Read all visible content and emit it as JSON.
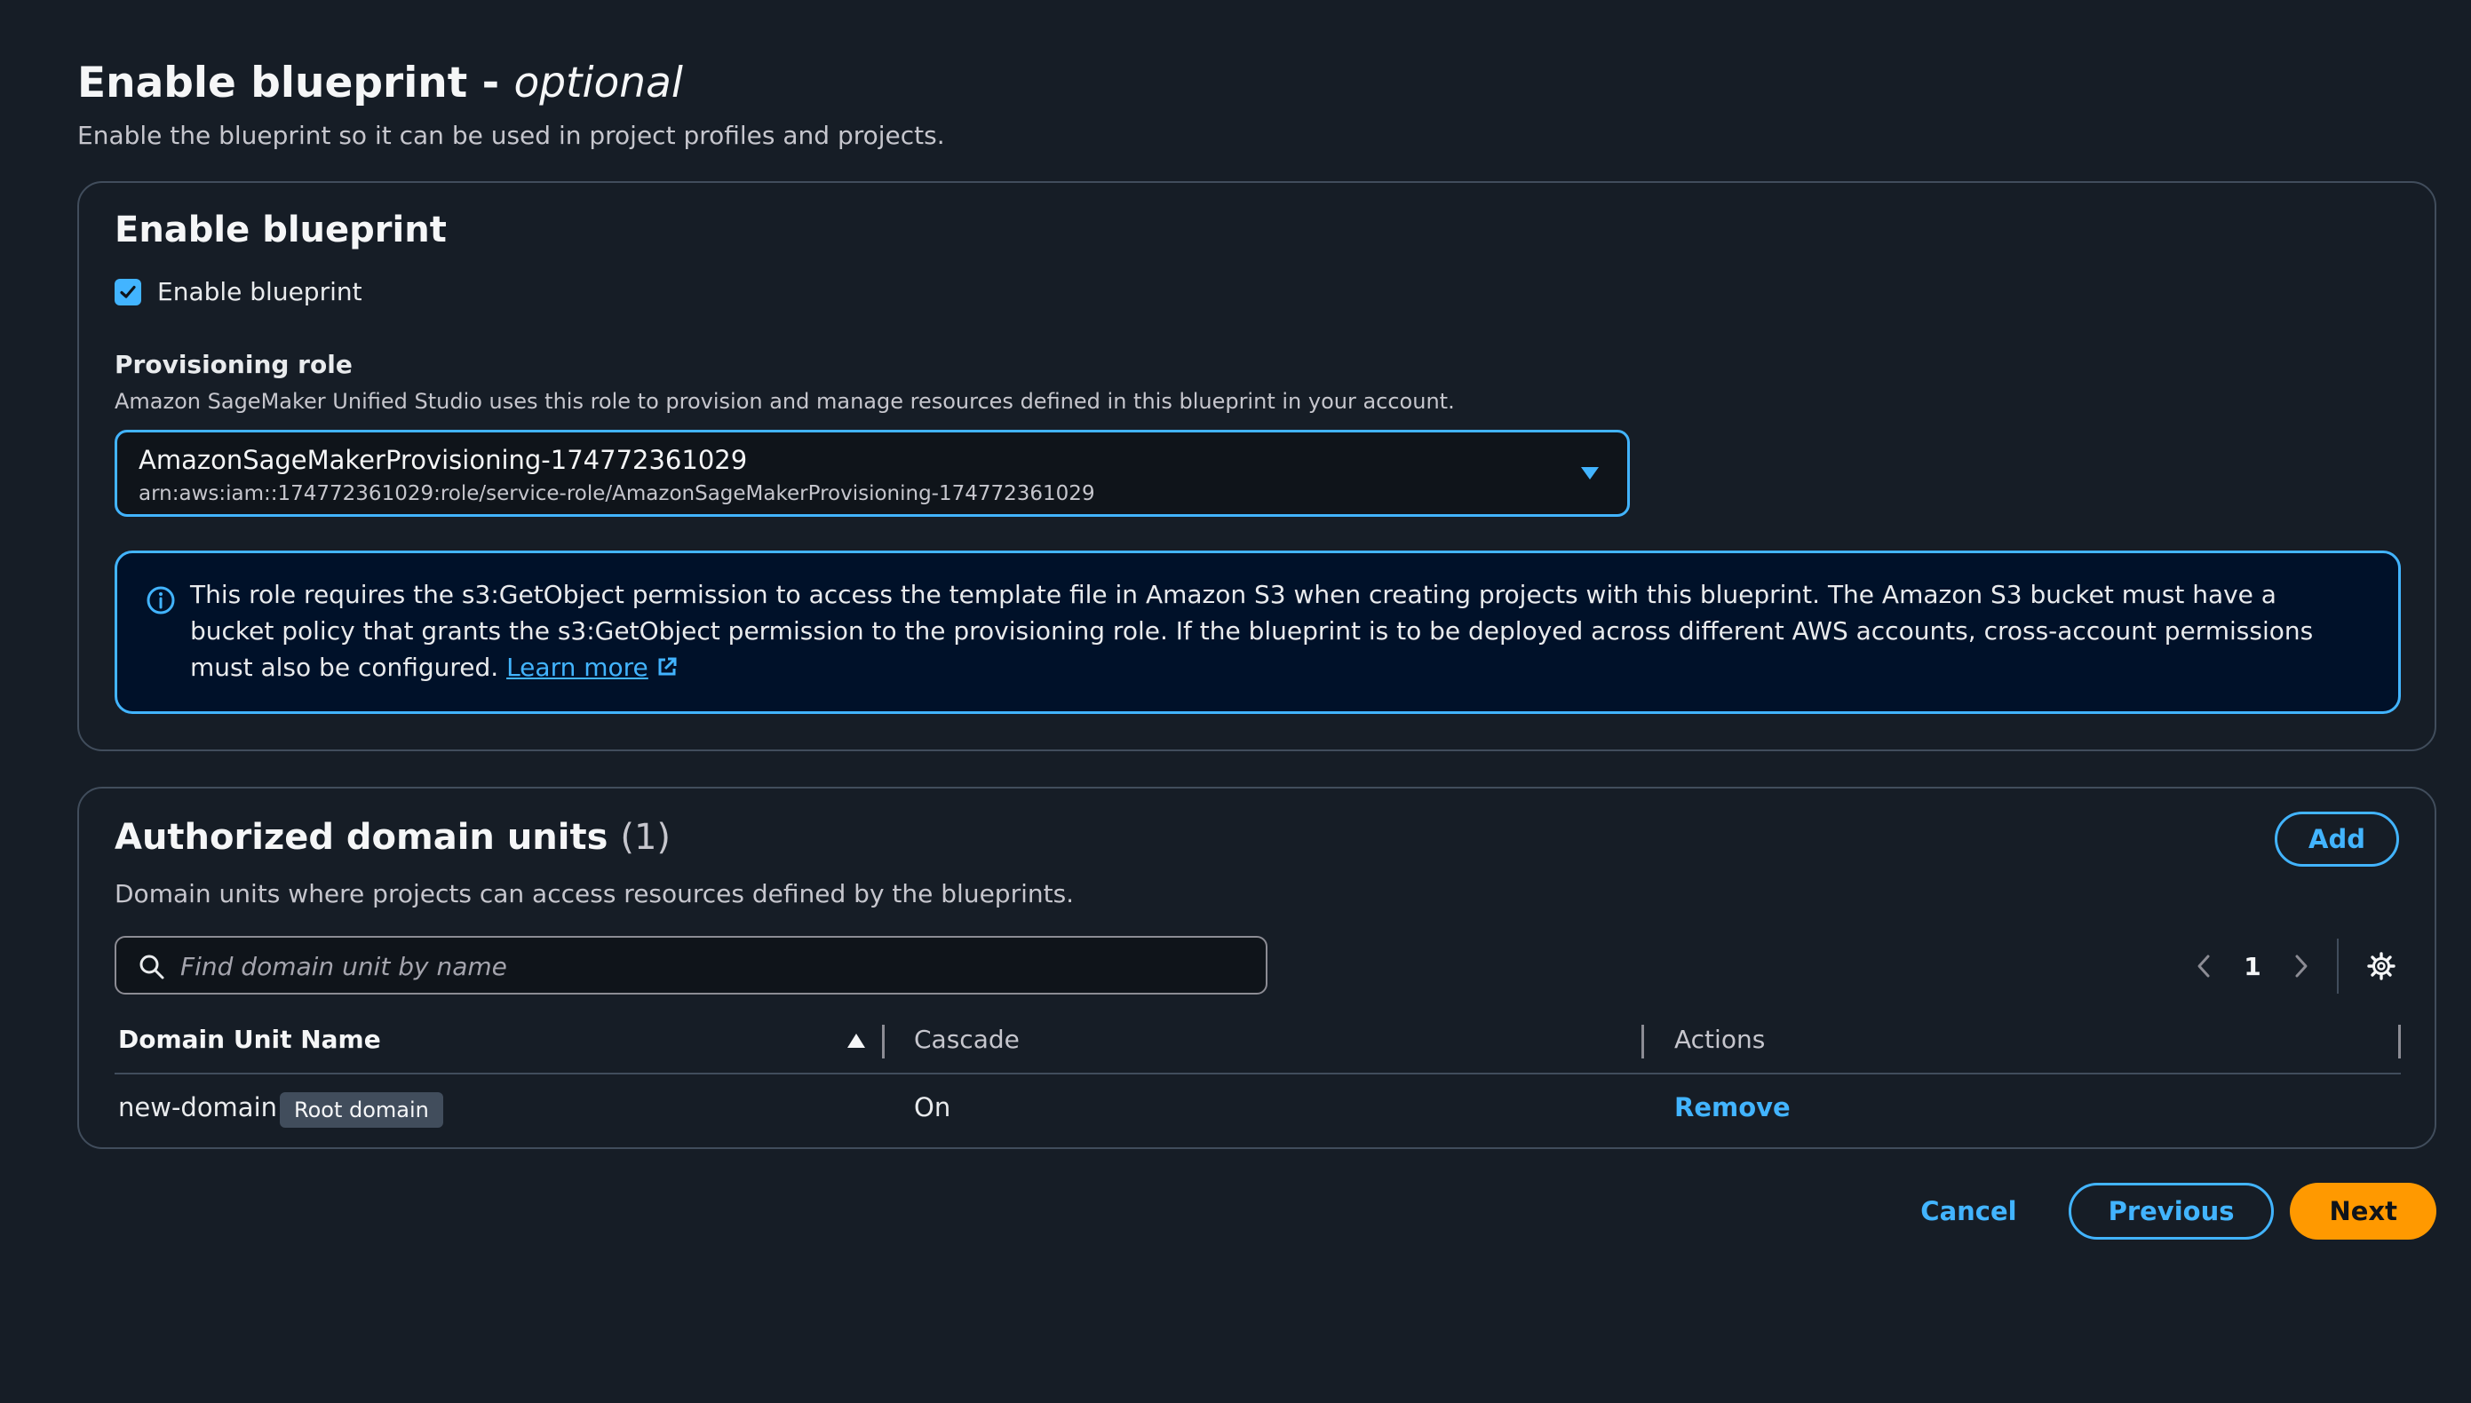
{
  "header": {
    "title": "Enable blueprint",
    "title_separator": " - ",
    "title_optional": "optional",
    "description": "Enable the blueprint so it can be used in project profiles and projects."
  },
  "enable_card": {
    "title": "Enable blueprint",
    "checkbox_label": "Enable blueprint",
    "checkbox_checked": true,
    "provisioning_label": "Provisioning role",
    "provisioning_description": "Amazon SageMaker Unified Studio uses this role to provision and manage resources defined in this blueprint in your account.",
    "role_name": "AmazonSageMakerProvisioning-174772361029",
    "role_arn": "arn:aws:iam::174772361029:role/service-role/AmazonSageMakerProvisioning-174772361029",
    "info_text": "This role requires the s3:GetObject permission to access the template file in Amazon S3 when creating projects with this blueprint. The Amazon S3 bucket must have a bucket policy that grants the s3:GetObject permission to the provisioning role. If the blueprint is to be deployed across different AWS accounts, cross-account permissions must also be configured.",
    "info_link": "Learn more"
  },
  "domain_units": {
    "title": "Authorized domain units",
    "count": "(1)",
    "add_label": "Add",
    "description": "Domain units where projects can access resources defined by the blueprints.",
    "search_placeholder": "Find domain unit by name",
    "page_number": "1",
    "columns": [
      "Domain Unit Name",
      "Cascade",
      "Actions"
    ],
    "rows": [
      {
        "name": "new-domain",
        "badge": "Root domain",
        "cascade": "On",
        "action": "Remove"
      }
    ]
  },
  "footer": {
    "cancel_label": "Cancel",
    "previous_label": "Previous",
    "next_label": "Next"
  },
  "colors": {
    "background": "#161d26",
    "accent": "#42b4ff",
    "primary_button": "#ff9900",
    "border": "#414d5c"
  }
}
